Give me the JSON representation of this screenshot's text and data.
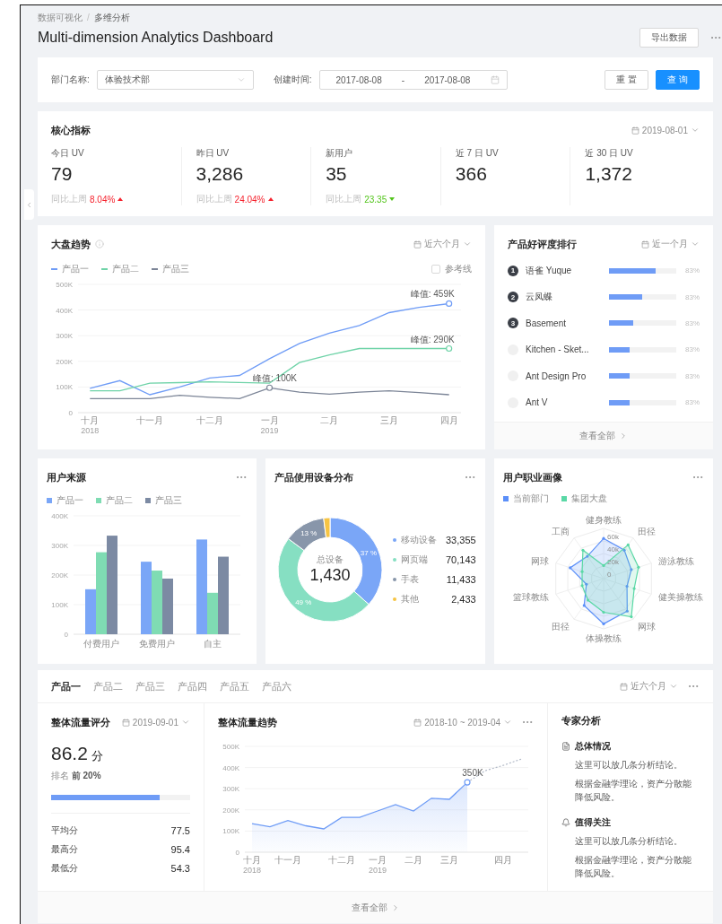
{
  "breadcrumb": {
    "items": [
      "数据可视化",
      "多维分析"
    ],
    "separator": "/"
  },
  "title": "Multi-dimension Analytics Dashboard",
  "export_button": "导出数据",
  "filters": {
    "department": {
      "label": "部门名称:",
      "value": "体验技术部"
    },
    "created": {
      "label": "创建时间:",
      "start": "2017-08-08",
      "separator": "-",
      "end": "2017-08-08"
    },
    "buttons": [
      {
        "label": "重 置",
        "primary": false
      },
      {
        "label": "查 询",
        "primary": true
      }
    ]
  },
  "core": {
    "title": "核心指标",
    "date": "2019-08-01",
    "metrics": [
      {
        "label": "今日 UV",
        "value": "79",
        "compare_label": "同比上周",
        "change": "8.04%",
        "increase": true
      },
      {
        "label": "昨日 UV",
        "value": "3,286",
        "compare_label": "同比上周",
        "change": "24.04%",
        "increase": true
      },
      {
        "label": "新用户",
        "value": "35",
        "compare_label": "同比上周",
        "change": "23.35",
        "increase": false
      },
      {
        "label": "近 7 日 UV",
        "value": "366"
      },
      {
        "label": "近 30 日 UV",
        "value": "1,372"
      }
    ]
  },
  "trend": {
    "title": "大盘趋势",
    "range": "近六个月",
    "reference": {
      "label": "参考线",
      "checked": false
    },
    "chart_data": {
      "type": "line",
      "grid": true,
      "categories": [
        "十月\n2018",
        null,
        "十一月",
        null,
        "十二月",
        null,
        "一月\n2019",
        null,
        "二月",
        null,
        "三月",
        null,
        "四月"
      ],
      "ylim": [
        0,
        500000
      ],
      "yticks": [
        {
          "value": 0,
          "label": "0"
        },
        {
          "value": 100000,
          "label": "100K"
        },
        {
          "value": 200000,
          "label": "200K"
        },
        {
          "value": 300000,
          "label": "300K"
        },
        {
          "value": 400000,
          "label": "400K"
        },
        {
          "value": 500000,
          "label": "500K"
        }
      ],
      "series": [
        {
          "name": "产品一",
          "color": "#6f9cf6",
          "values": [
            95000,
            125000,
            70000,
            100000,
            135000,
            145000,
            210000,
            270000,
            310000,
            340000,
            390000,
            410000,
            425000
          ]
        },
        {
          "name": "产品二",
          "color": "#6fd3a8",
          "values": [
            85000,
            85000,
            115000,
            117000,
            120000,
            118000,
            115000,
            195000,
            225000,
            250000,
            250000,
            250000,
            250000
          ]
        },
        {
          "name": "产品三",
          "color": "#7c8597",
          "values": [
            55000,
            55000,
            55000,
            68000,
            60000,
            55000,
            97000,
            80000,
            72000,
            80000,
            85000,
            78000,
            70000
          ]
        }
      ],
      "annotations": [
        {
          "y": 425000,
          "text": "峰值: 459K"
        },
        {
          "y": 250000,
          "text": "峰值: 290K"
        },
        {
          "y": 97000,
          "text": "峰值: 100K"
        }
      ]
    }
  },
  "ranking": {
    "title": "产品好评度排行",
    "range": "近一个月",
    "footer": "查看全部",
    "items": [
      {
        "rank": "1",
        "top": true,
        "name": "语雀 Yuque",
        "level": 0.69,
        "percent": "83%"
      },
      {
        "rank": "2",
        "top": true,
        "name": "云凤蝶",
        "level": 0.49,
        "percent": "83%"
      },
      {
        "rank": "3",
        "top": true,
        "name": "Basement",
        "level": 0.36,
        "percent": "83%"
      },
      {
        "top": false,
        "name": "Kitchen - Sket...",
        "level": 0.3,
        "percent": "83%"
      },
      {
        "top": false,
        "name": "Ant Design Pro",
        "level": 0.3,
        "percent": "83%"
      },
      {
        "top": false,
        "name": "Ant V",
        "level": 0.3,
        "percent": "83%"
      }
    ]
  },
  "sources": {
    "title": "用户来源",
    "chart_data": {
      "type": "bar",
      "grid": true,
      "categories": [
        "付费用户",
        "免费用户",
        "自主"
      ],
      "ylim": [
        0,
        400000
      ],
      "yticks": [
        {
          "value": 0,
          "label": "0"
        },
        {
          "value": 100000,
          "label": "100K"
        },
        {
          "value": 200000,
          "label": "200K"
        },
        {
          "value": 300000,
          "label": "300K"
        },
        {
          "value": 400000,
          "label": "400K"
        }
      ],
      "series": [
        {
          "name": "产品一",
          "color": "#7aa6f7",
          "values": [
            152000,
            245000,
            320000
          ]
        },
        {
          "name": "产品二",
          "color": "#7fdcb3",
          "values": [
            277000,
            215000,
            140000
          ]
        },
        {
          "name": "产品三",
          "color": "#7c8aa3",
          "values": [
            333000,
            188000,
            262000
          ]
        }
      ]
    }
  },
  "devices": {
    "title": "产品使用设备分布",
    "center_label": "总设备",
    "center_value": "1,430",
    "chart_data": {
      "type": "donut",
      "categories": [
        "移动设备",
        "网页端",
        "手表",
        "其他"
      ],
      "values": [
        37,
        49,
        13,
        2
      ],
      "value_labels": [
        "37 %",
        "49 %",
        "13 %",
        null
      ]
    },
    "legend": [
      {
        "value": "33,355",
        "color": "#7aa6f7"
      },
      {
        "value": "70,143",
        "color": "#86dfc2"
      },
      {
        "value": "11,433",
        "color": "#8896aa"
      },
      {
        "value": "2,433",
        "color": "#f6c443"
      }
    ]
  },
  "occupation": {
    "title": "用户职业画像",
    "legend": [
      {
        "label": "当前部门",
        "color": "#5b8ff9"
      },
      {
        "label": "集团大盘",
        "color": "#5ad8a6"
      }
    ],
    "axes": [
      "健身教练",
      "田径",
      "游泳教练",
      "健美操教练",
      "网球",
      "体操教练",
      "田径",
      "篮球教练",
      "网球",
      "工商"
    ],
    "ticks": [
      "60k",
      "40k",
      "20k",
      "0"
    ]
  },
  "bottom": {
    "tabs": [
      {
        "label": "产品一",
        "selected": true
      },
      {
        "label": "产品二",
        "selected": false
      },
      {
        "label": "产品三",
        "selected": false
      },
      {
        "label": "产品四",
        "selected": false
      },
      {
        "label": "产品五",
        "selected": false
      },
      {
        "label": "产品六",
        "selected": false
      }
    ],
    "range": "近六个月",
    "score": {
      "title": "整体流量评分",
      "date": "2019-09-01",
      "value": "86.2",
      "unit": "分",
      "rank": "排名 **前 20%**",
      "level": 0.78,
      "stats": [
        {
          "label": "平均分",
          "value": "77.5"
        },
        {
          "label": "最高分",
          "value": "95.4"
        },
        {
          "label": "最低分",
          "value": "54.3"
        }
      ]
    },
    "traffic": {
      "title": "整体流量趋势",
      "range": "2018-10 ~ 2019-04",
      "chart_data": {
        "type": "area",
        "grid": true,
        "categories": [
          "十月\n2018",
          null,
          "十一月",
          null,
          null,
          "十二月",
          null,
          "一月\n2019",
          null,
          "二月",
          null,
          "三月",
          null,
          null,
          "四月",
          null
        ],
        "ylim": [
          0,
          500000
        ],
        "yticks": [
          {
            "value": 0,
            "label": "0"
          },
          {
            "value": 100000,
            "label": "100K"
          },
          {
            "value": 200000,
            "label": "200K"
          },
          {
            "value": 300000,
            "label": "300K"
          },
          {
            "value": 400000,
            "label": "400K"
          },
          {
            "value": 500000,
            "label": "500K"
          }
        ],
        "series": [
          {
            "type": "area",
            "color": "#6f9cf6",
            "values": [
              135000,
              120000,
              150000,
              125000,
              110000,
              165000,
              165000,
              195000,
              225000,
              195000,
              255000,
              250000,
              330000,
              null,
              null,
              null
            ]
          },
          {
            "type": "line",
            "line_style": "dashed",
            "color": "#b0b8c6",
            "values": [
              null,
              null,
              null,
              null,
              null,
              null,
              null,
              null,
              null,
              null,
              null,
              null,
              330000,
              385000,
              410000,
              440000
            ]
          }
        ],
        "annotations": [
          {
            "y": 330000,
            "text": "350K"
          }
        ]
      }
    },
    "expert": {
      "title": "专家分析",
      "sections": [
        {
          "heading": "总体情况",
          "paragraphs": [
            "这里可以放几条分析结论。",
            "根据金融学理论，资产分散能降低风险。"
          ]
        },
        {
          "heading": "值得关注",
          "paragraphs": [
            "这里可以放几条分析结论。",
            "根据金融学理论，资产分散能降低风险。"
          ]
        }
      ]
    },
    "footer": "查看全部"
  }
}
